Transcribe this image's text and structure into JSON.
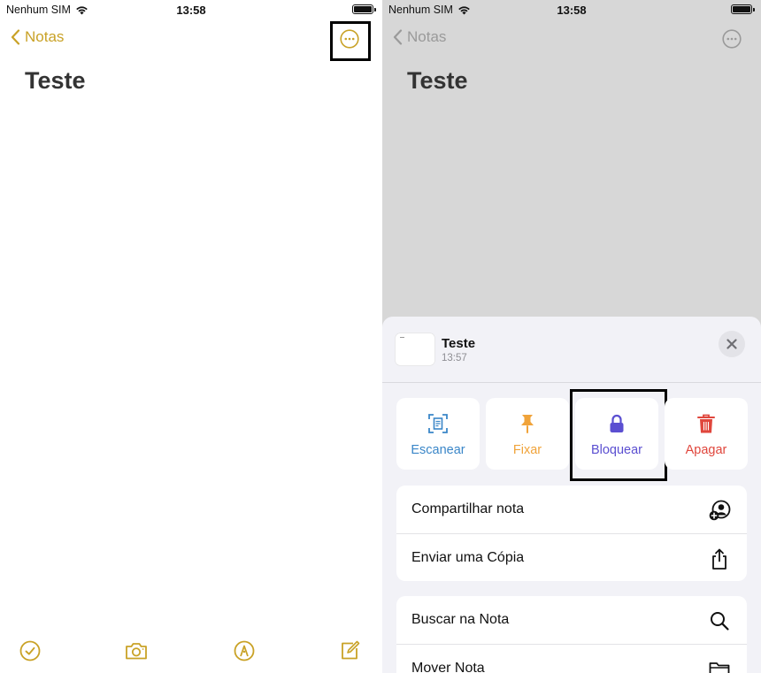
{
  "status": {
    "carrier": "Nenhum SIM",
    "time": "13:58"
  },
  "nav": {
    "back_label": "Notas"
  },
  "note": {
    "title": "Teste"
  },
  "sheet": {
    "note_title": "Teste",
    "note_time": "13:57",
    "actions": [
      {
        "label": "Escanear",
        "color": "#3a86c8"
      },
      {
        "label": "Fixar",
        "color": "#f0a33a"
      },
      {
        "label": "Bloquear",
        "color": "#5b4fd1"
      },
      {
        "label": "Apagar",
        "color": "#e0463c"
      }
    ],
    "group1": [
      {
        "label": "Compartilhar nota"
      },
      {
        "label": "Enviar uma Cópia"
      }
    ],
    "group2": [
      {
        "label": "Buscar na Nota"
      },
      {
        "label": "Mover Nota"
      }
    ]
  },
  "colors": {
    "accent": "#c9a227",
    "dimmed_bg": "#d7d7d7",
    "sheet_bg": "#f2f2f7"
  }
}
